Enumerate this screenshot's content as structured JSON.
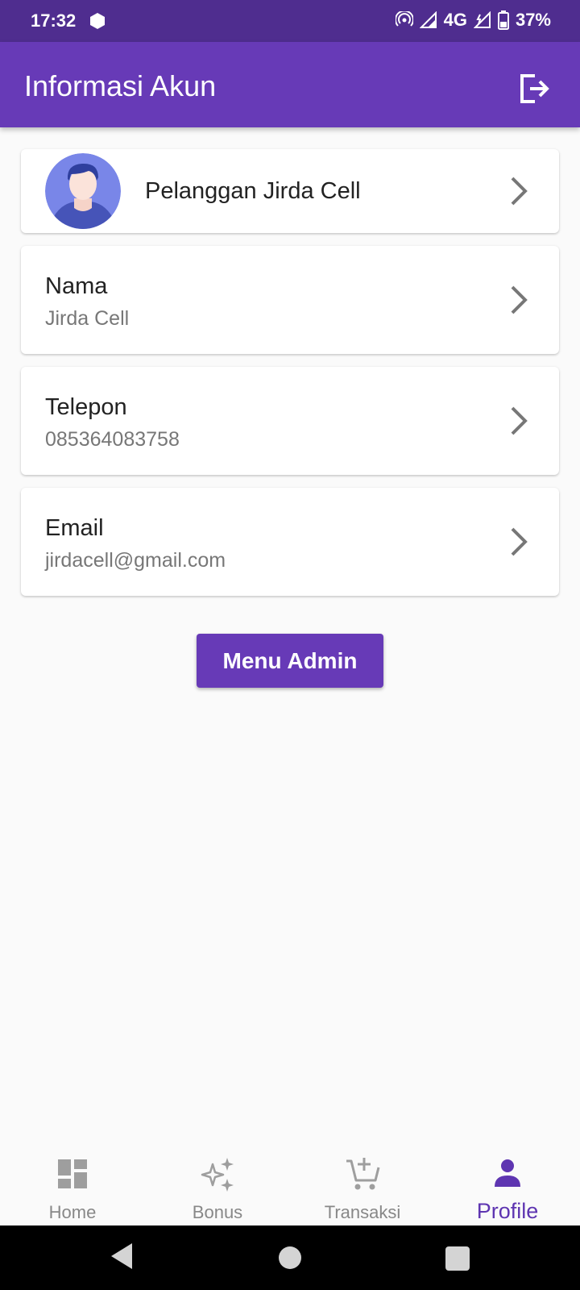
{
  "status_bar": {
    "time": "17:32",
    "network": "4G",
    "battery": "37%"
  },
  "app_bar": {
    "title": "Informasi Akun",
    "logout_icon": "logout-icon"
  },
  "profile": {
    "name": "Pelanggan Jirda Cell",
    "avatar_icon": "user-avatar-icon"
  },
  "fields": {
    "nama": {
      "label": "Nama",
      "value": "Jirda Cell"
    },
    "telepon": {
      "label": "Telepon",
      "value": "085364083758"
    },
    "email": {
      "label": "Email",
      "value": "jirdacell@gmail.com"
    }
  },
  "menu_admin": {
    "label": "Menu Admin"
  },
  "bottom_nav": {
    "items": [
      {
        "label": "Home",
        "icon": "dashboard-icon"
      },
      {
        "label": "Bonus",
        "icon": "sparkle-icon"
      },
      {
        "label": "Transaksi",
        "icon": "cart-add-icon"
      },
      {
        "label": "Profile",
        "icon": "person-icon"
      }
    ],
    "active": "Profile"
  },
  "colors": {
    "primary": "#673ab7",
    "status_bar": "#4f2d8f",
    "active_nav": "#5e35b1",
    "inactive_nav": "#888888"
  }
}
